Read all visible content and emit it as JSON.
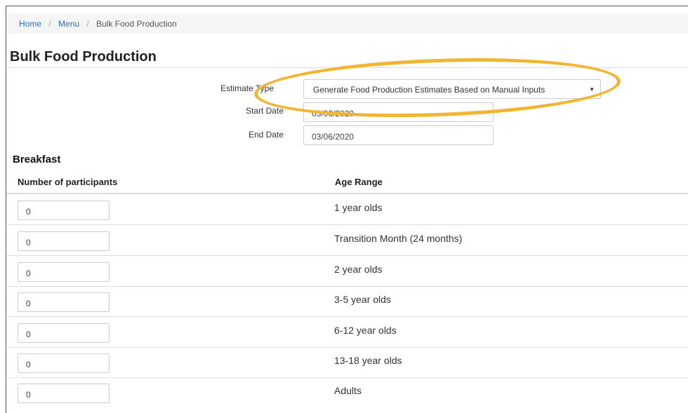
{
  "breadcrumb": {
    "home": "Home",
    "menu": "Menu",
    "current": "Bulk Food Production",
    "separator": "/"
  },
  "page": {
    "title": "Bulk Food Production"
  },
  "form": {
    "estimate_type_label": "Estimate Type",
    "estimate_type_value": "Generate Food Production Estimates Based on Manual Inputs",
    "start_date_label": "Start Date",
    "start_date_value": "03/06/2020",
    "end_date_label": "End Date",
    "end_date_value": "03/06/2020"
  },
  "breakfast": {
    "title": "Breakfast",
    "col_participants": "Number of participants",
    "col_age_range": "Age Range",
    "rows": [
      {
        "count": "0",
        "age": "1 year olds"
      },
      {
        "count": "0",
        "age": "Transition Month (24 months)"
      },
      {
        "count": "0",
        "age": "2 year olds"
      },
      {
        "count": "0",
        "age": "3-5 year olds"
      },
      {
        "count": "0",
        "age": "6-12 year olds"
      },
      {
        "count": "0",
        "age": "13-18 year olds"
      },
      {
        "count": "0",
        "age": "Adults"
      }
    ]
  },
  "colors": {
    "highlight": "#f2b531",
    "link": "#2a6ebb"
  },
  "icons": {
    "select_caret": "caret-down-icon"
  }
}
